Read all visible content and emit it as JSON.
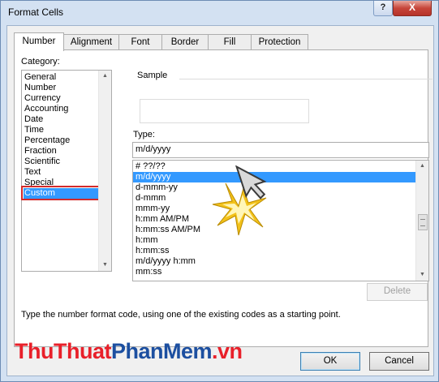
{
  "window": {
    "title": "Format Cells",
    "help_glyph": "?",
    "close_glyph": "X"
  },
  "tabs": [
    {
      "label": "Number",
      "active": true
    },
    {
      "label": "Alignment",
      "active": false
    },
    {
      "label": "Font",
      "active": false
    },
    {
      "label": "Border",
      "active": false
    },
    {
      "label": "Fill",
      "active": false
    },
    {
      "label": "Protection",
      "active": false
    }
  ],
  "category": {
    "label": "Category:",
    "items": [
      "General",
      "Number",
      "Currency",
      "Accounting",
      "Date",
      "Time",
      "Percentage",
      "Fraction",
      "Scientific",
      "Text",
      "Special",
      "Custom"
    ],
    "selected": "Custom"
  },
  "sample": {
    "label": "Sample"
  },
  "type": {
    "label": "Type:",
    "value": "m/d/yyyy",
    "items": [
      "# ??/??",
      "m/d/yyyy",
      "d-mmm-yy",
      "d-mmm",
      "mmm-yy",
      "h:mm AM/PM",
      "h:mm:ss AM/PM",
      "h:mm",
      "h:mm:ss",
      "m/d/yyyy h:mm",
      "mm:ss"
    ],
    "selected": "m/d/yyyy"
  },
  "buttons": {
    "delete": "Delete",
    "ok": "OK",
    "cancel": "Cancel"
  },
  "description": "Type the number format code, using one of the existing codes as a starting point.",
  "watermark": {
    "part1": "ThuThuat",
    "part2": "PhanMem",
    "part3": ".vn"
  },
  "colors": {
    "selection": "#3399ff",
    "highlight_box": "#d32a2a",
    "close_button": "#c7463a",
    "watermark_red": "#e8202a",
    "watermark_blue": "#1c4fa0"
  },
  "icons": {
    "cursor": "arrow-cursor-icon",
    "click_burst": "star-burst-icon"
  }
}
